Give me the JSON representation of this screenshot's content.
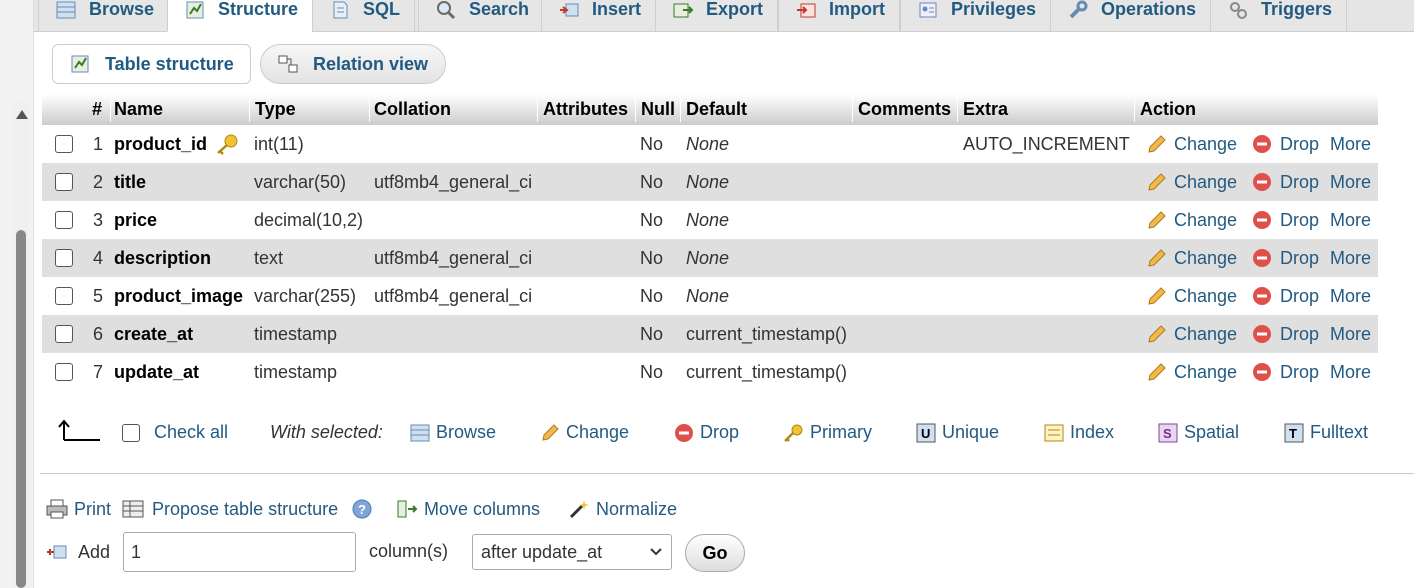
{
  "tabs": [
    {
      "label": "Browse",
      "icon": "table-browse-icon"
    },
    {
      "label": "Structure",
      "icon": "structure-icon",
      "active": true
    },
    {
      "label": "SQL",
      "icon": "sql-icon"
    },
    {
      "label": "Search",
      "icon": "search-icon"
    },
    {
      "label": "Insert",
      "icon": "insert-icon"
    },
    {
      "label": "Export",
      "icon": "export-icon"
    },
    {
      "label": "Import",
      "icon": "import-icon"
    },
    {
      "label": "Privileges",
      "icon": "privileges-icon"
    },
    {
      "label": "Operations",
      "icon": "wrench-icon"
    },
    {
      "label": "Triggers",
      "icon": "triggers-icon"
    }
  ],
  "subtabs": {
    "table_structure": "Table structure",
    "relation_view": "Relation view"
  },
  "columns": {
    "num": "#",
    "name": "Name",
    "type": "Type",
    "collation": "Collation",
    "attributes": "Attributes",
    "null": "Null",
    "default": "Default",
    "comments": "Comments",
    "extra": "Extra",
    "action": "Action"
  },
  "rows": [
    {
      "num": "1",
      "name": "product_id",
      "type": "int(11)",
      "collation": "",
      "null": "No",
      "default": "None",
      "extra": "AUTO_INCREMENT",
      "primary_key": true
    },
    {
      "num": "2",
      "name": "title",
      "type": "varchar(50)",
      "collation": "utf8mb4_general_ci",
      "null": "No",
      "default": "None",
      "extra": ""
    },
    {
      "num": "3",
      "name": "price",
      "type": "decimal(10,2)",
      "collation": "",
      "null": "No",
      "default": "None",
      "extra": ""
    },
    {
      "num": "4",
      "name": "description",
      "type": "text",
      "collation": "utf8mb4_general_ci",
      "null": "No",
      "default": "None",
      "extra": ""
    },
    {
      "num": "5",
      "name": "product_image",
      "type": "varchar(255)",
      "collation": "utf8mb4_general_ci",
      "null": "No",
      "default": "None",
      "extra": ""
    },
    {
      "num": "6",
      "name": "create_at",
      "type": "timestamp",
      "collation": "",
      "null": "No",
      "default": "current_timestamp()",
      "extra": ""
    },
    {
      "num": "7",
      "name": "update_at",
      "type": "timestamp",
      "collation": "",
      "null": "No",
      "default": "current_timestamp()",
      "extra": ""
    }
  ],
  "row_actions": {
    "change": "Change",
    "drop": "Drop",
    "more": "More"
  },
  "bulk": {
    "check_all": "Check all",
    "with_selected": "With selected:",
    "browse": "Browse",
    "change": "Change",
    "drop": "Drop",
    "primary": "Primary",
    "unique": "Unique",
    "index": "Index",
    "spatial": "Spatial",
    "fulltext": "Fulltext"
  },
  "links": {
    "print": "Print",
    "propose": "Propose table structure",
    "move_columns": "Move columns",
    "normalize": "Normalize"
  },
  "add": {
    "label": "Add",
    "value": "1",
    "unit": "column(s)",
    "position": "after update_at",
    "go": "Go"
  },
  "colors": {
    "link": "#235a81",
    "drop_red": "#e0504a",
    "pencil": "#e8a33a"
  }
}
